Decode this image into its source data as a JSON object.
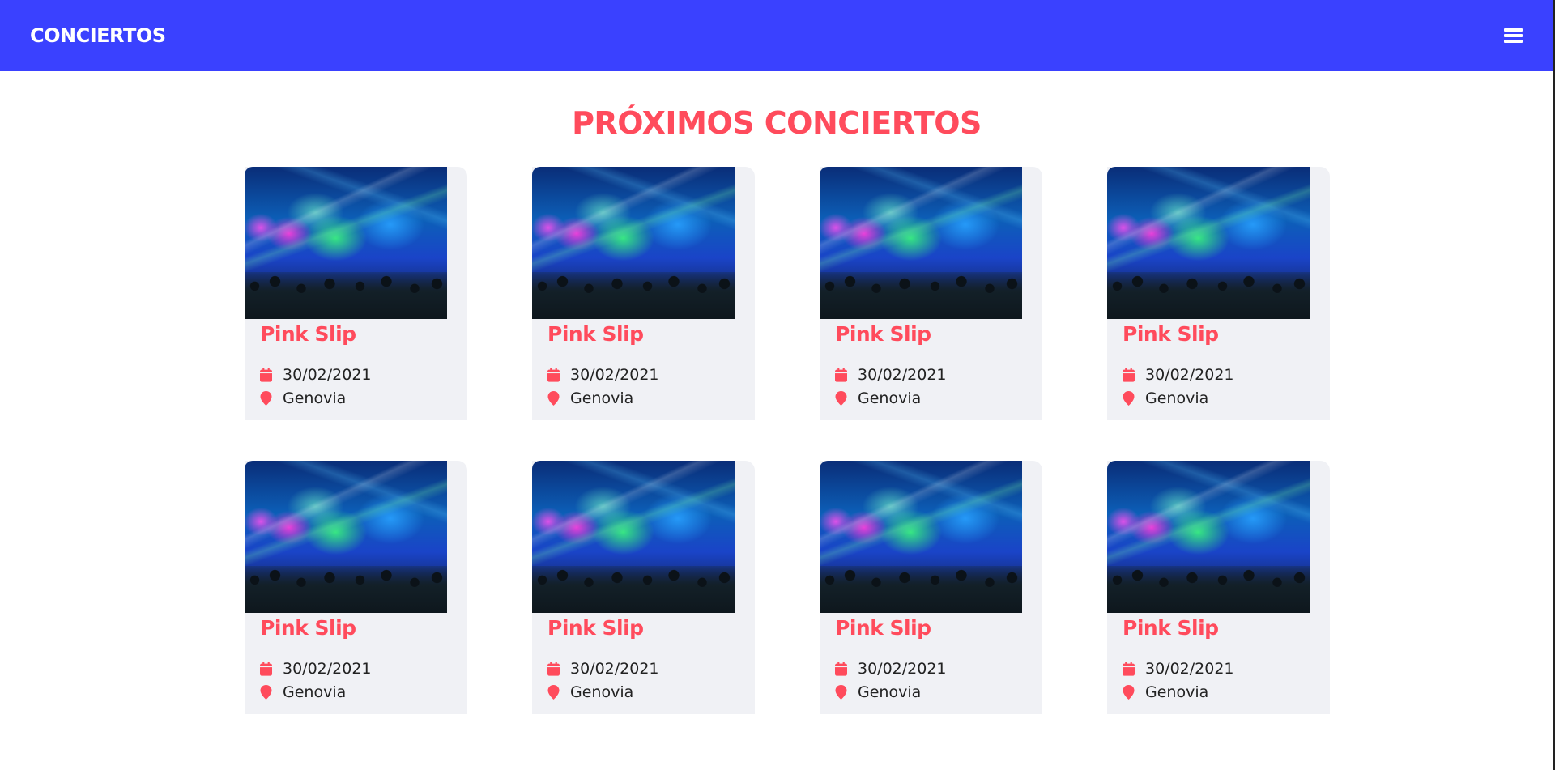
{
  "navbar": {
    "brand": "CONCIERTOS",
    "menu_icon": "hamburger-menu-icon"
  },
  "page": {
    "title": "PRÓXIMOS CONCIERTOS"
  },
  "colors": {
    "navbar_bg": "#3a41ff",
    "accent": "#ff4b5c",
    "card_bg": "#f0f1f5"
  },
  "concerts": [
    {
      "title": "Pink Slip",
      "date": "30/02/2021",
      "location": "Genovia",
      "image": "concert-crowd-stage-lights"
    },
    {
      "title": "Pink Slip",
      "date": "30/02/2021",
      "location": "Genovia",
      "image": "concert-crowd-stage-lights"
    },
    {
      "title": "Pink Slip",
      "date": "30/02/2021",
      "location": "Genovia",
      "image": "concert-crowd-stage-lights"
    },
    {
      "title": "Pink Slip",
      "date": "30/02/2021",
      "location": "Genovia",
      "image": "concert-crowd-stage-lights"
    },
    {
      "title": "Pink Slip",
      "date": "30/02/2021",
      "location": "Genovia",
      "image": "concert-crowd-stage-lights"
    },
    {
      "title": "Pink Slip",
      "date": "30/02/2021",
      "location": "Genovia",
      "image": "concert-crowd-stage-lights"
    },
    {
      "title": "Pink Slip",
      "date": "30/02/2021",
      "location": "Genovia",
      "image": "concert-crowd-stage-lights"
    },
    {
      "title": "Pink Slip",
      "date": "30/02/2021",
      "location": "Genovia",
      "image": "concert-crowd-stage-lights"
    }
  ]
}
